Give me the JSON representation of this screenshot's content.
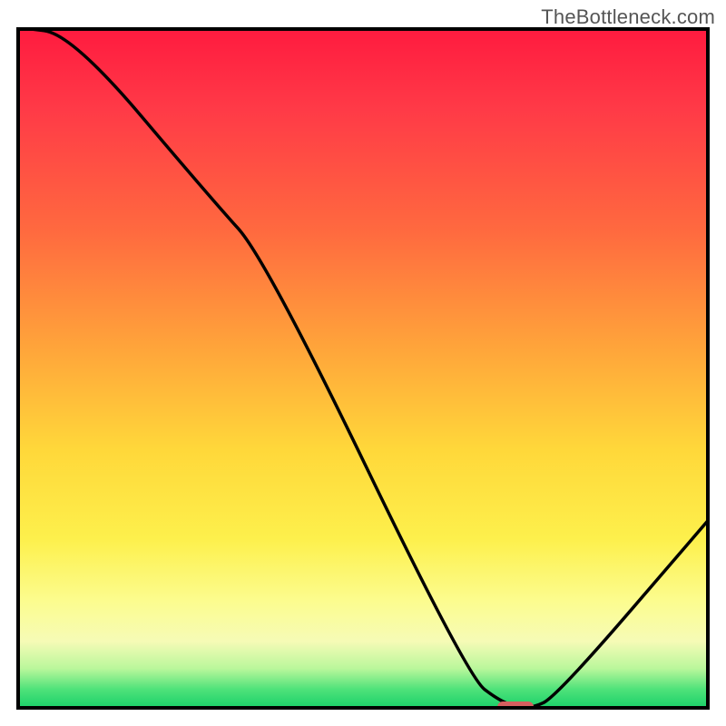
{
  "watermark": "TheBottleneck.com",
  "chart_data": {
    "type": "line",
    "title": "",
    "xlabel": "",
    "ylabel": "",
    "xlim": [
      0,
      100
    ],
    "ylim": [
      0,
      100
    ],
    "x": [
      0,
      8,
      28,
      36,
      65,
      70,
      74,
      78,
      100
    ],
    "values": [
      100,
      99,
      75,
      66,
      5,
      1,
      0,
      2,
      28
    ],
    "note": "values estimated from curve height (0 = bottom, 100 = top)",
    "gradient_stops": [
      {
        "pos": 0,
        "color": "#ff1a3f"
      },
      {
        "pos": 12,
        "color": "#ff3a47"
      },
      {
        "pos": 30,
        "color": "#ff6a3f"
      },
      {
        "pos": 48,
        "color": "#ffa83a"
      },
      {
        "pos": 62,
        "color": "#ffd83a"
      },
      {
        "pos": 75,
        "color": "#fdf04c"
      },
      {
        "pos": 84,
        "color": "#fcfc8e"
      },
      {
        "pos": 90,
        "color": "#f6fbb6"
      },
      {
        "pos": 94,
        "color": "#b9f79b"
      },
      {
        "pos": 97,
        "color": "#4fe27a"
      },
      {
        "pos": 100,
        "color": "#15cf68"
      }
    ],
    "marker": {
      "x": 72,
      "y": 0,
      "color": "#d65f5f",
      "shape": "pill"
    }
  }
}
